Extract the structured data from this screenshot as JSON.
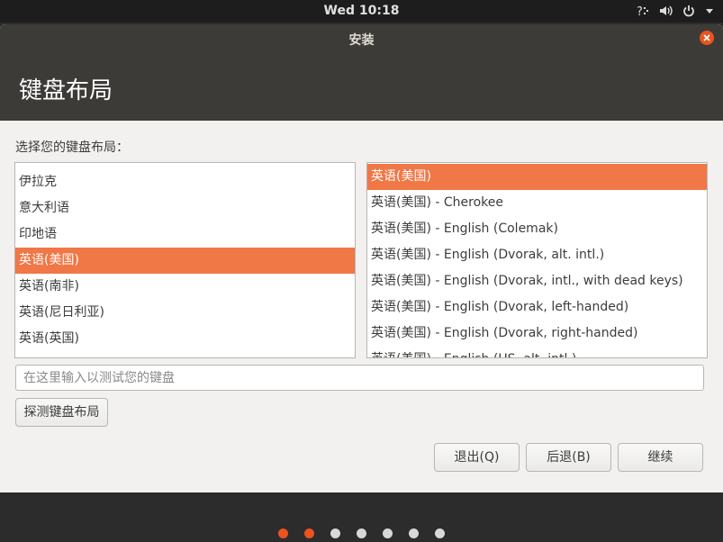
{
  "topbar": {
    "clock": "Wed 10:18",
    "icons": [
      "accessibility-icon",
      "volume-icon",
      "power-icon",
      "chevron-down-icon"
    ]
  },
  "window": {
    "title": "安装",
    "page_title": "键盘布局",
    "prompt": "选择您的键盘布局：",
    "layouts": [
      {
        "label": "伊拉克",
        "selected": false
      },
      {
        "label": "意大利语",
        "selected": false
      },
      {
        "label": "印地语",
        "selected": false
      },
      {
        "label": "英语(美国)",
        "selected": true
      },
      {
        "label": "英语(南非)",
        "selected": false
      },
      {
        "label": "英语(尼日利亚)",
        "selected": false
      },
      {
        "label": "英语(英国)",
        "selected": false
      }
    ],
    "variants": [
      {
        "label": "英语(美国)",
        "selected": true
      },
      {
        "label": "英语(美国) - Cherokee",
        "selected": false
      },
      {
        "label": "英语(美国) - English (Colemak)",
        "selected": false
      },
      {
        "label": "英语(美国) - English (Dvorak, alt. intl.)",
        "selected": false
      },
      {
        "label": "英语(美国) - English (Dvorak, intl., with dead keys)",
        "selected": false
      },
      {
        "label": "英语(美国) - English (Dvorak, left-handed)",
        "selected": false
      },
      {
        "label": "英语(美国) - English (Dvorak, right-handed)",
        "selected": false
      },
      {
        "label": "英语(美国) - English (US, alt. intl.)",
        "selected": false
      }
    ],
    "test_placeholder": "在这里输入以测试您的键盘",
    "detect_button": "探测键盘布局",
    "quit_button": "退出(Q)",
    "back_button": "后退(B)",
    "continue_button": "继续"
  },
  "progress": {
    "total_steps": 7,
    "active_steps": [
      0,
      1
    ]
  },
  "colors": {
    "accent": "#e95420",
    "selection": "#f07746",
    "header": "#3c3b37"
  }
}
